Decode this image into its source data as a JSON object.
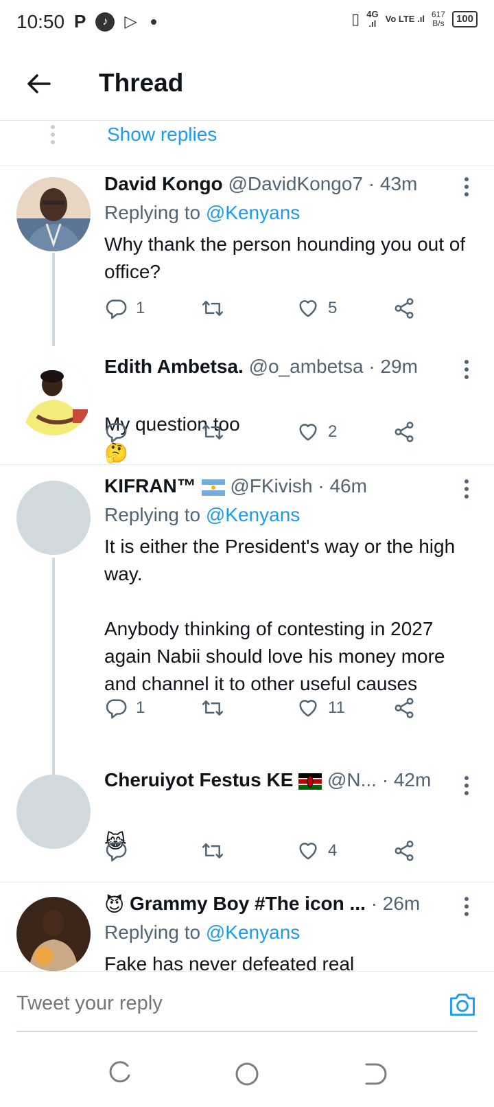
{
  "status_bar": {
    "time": "10:50",
    "p_icon": "P",
    "net_4g": "4G",
    "volte": "Vo LTE",
    "speed_value": "617",
    "speed_unit": "B/s",
    "battery": "100"
  },
  "header": {
    "title": "Thread"
  },
  "show_replies": {
    "label": "Show replies"
  },
  "tweets": [
    {
      "name": "David Kongo",
      "handle": "@DavidKongo7",
      "sep": "·",
      "time": "43m",
      "replying_prefix": "Replying to",
      "replying_to": "@Kenyans",
      "text": "Why thank the person hounding you out of office?",
      "reply_count": "1",
      "retweet_count": "",
      "like_count": "5"
    },
    {
      "name": "Edith Ambetsa.",
      "handle": "@o_ambetsa",
      "sep": "·",
      "time": "29m",
      "text": "My question too",
      "emoji": "🤔",
      "reply_count": "",
      "retweet_count": "",
      "like_count": "2"
    },
    {
      "name": "KIFRAN™",
      "handle": "@FKivish",
      "sep": "·",
      "time": "46m",
      "replying_prefix": "Replying to",
      "replying_to": "@Kenyans",
      "text": "It is either the President's way or the high way.\n\nAnybody thinking of contesting in 2027 again Nabii should love his money more and channel it to other useful causes",
      "reply_count": "1",
      "retweet_count": "",
      "like_count": "11"
    },
    {
      "name": "Cheruiyot Festus KE",
      "handle": "@N...",
      "sep": "·",
      "time": "42m",
      "emoji": "😹",
      "reply_count": "",
      "retweet_count": "",
      "like_count": "4"
    },
    {
      "name_emoji": "😈",
      "name": "Grammy Boy #The icon ...",
      "sep": "·",
      "time": "26m",
      "replying_prefix": "Replying to",
      "replying_to": "@Kenyans",
      "text": "Fake has never defeated real"
    }
  ],
  "reply_bar": {
    "placeholder": "Tweet your reply"
  },
  "colors": {
    "accent": "#1d9bf0",
    "text_primary": "#0f1419",
    "text_secondary": "#536471",
    "divider": "#e6e9ec"
  },
  "icons": [
    "back-arrow-icon",
    "more-vertical-icon",
    "reply-icon",
    "retweet-icon",
    "like-icon",
    "share-icon",
    "camera-icon",
    "argentina-flag-icon",
    "kenya-flag-icon",
    "recents-nav-icon",
    "home-nav-icon",
    "back-nav-icon"
  ]
}
